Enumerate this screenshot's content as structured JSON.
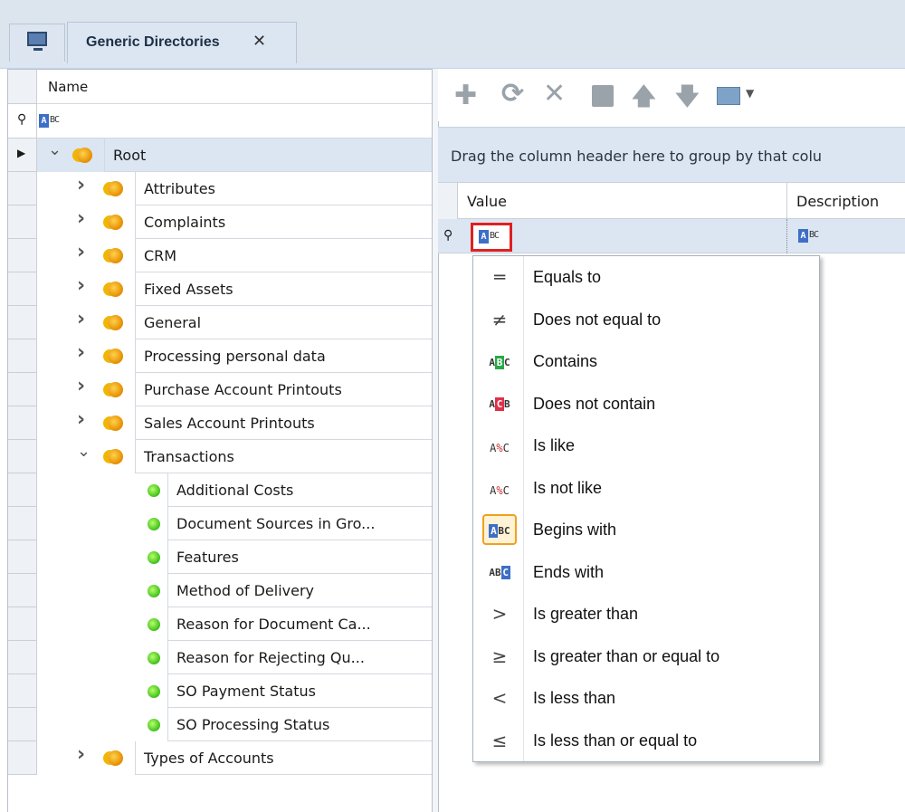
{
  "tabs": {
    "active_label": "Generic Directories",
    "close_glyph": "✕"
  },
  "tree": {
    "column_header": "Name",
    "filter_glyph": "ABC",
    "root_label": "Root",
    "nodes": [
      "Attributes",
      "Complaints",
      "CRM",
      "Fixed Assets",
      "General",
      "Processing personal data",
      "Purchase Account Printouts",
      "Sales Account Printouts",
      "Transactions"
    ],
    "transaction_children": [
      "Additional Costs",
      "Document Sources in Gro...",
      "Features",
      "Method of Delivery",
      "Reason for Document Ca...",
      "Reason for Rejecting Qu...",
      "SO Payment Status",
      "SO Processing Status"
    ],
    "last_node": "Types of Accounts"
  },
  "grid": {
    "group_hint": "Drag the column header here to group by that colu",
    "columns": [
      "Value",
      "Description"
    ]
  },
  "filter_menu": {
    "items": [
      "Equals to",
      "Does not equal to",
      "Contains",
      "Does not contain",
      "Is like",
      "Is not like",
      "Begins with",
      "Ends with",
      "Is greater than",
      "Is greater than or equal to",
      "Is less than",
      "Is less than or equal to"
    ],
    "selected": "Begins with"
  },
  "colors": {
    "accent_blue": "#3d6fc7",
    "selection": "#dbe6f2",
    "highlight_red": "#e02020",
    "contains_green": "#2aa84a",
    "not_contains_red": "#e0304a"
  }
}
